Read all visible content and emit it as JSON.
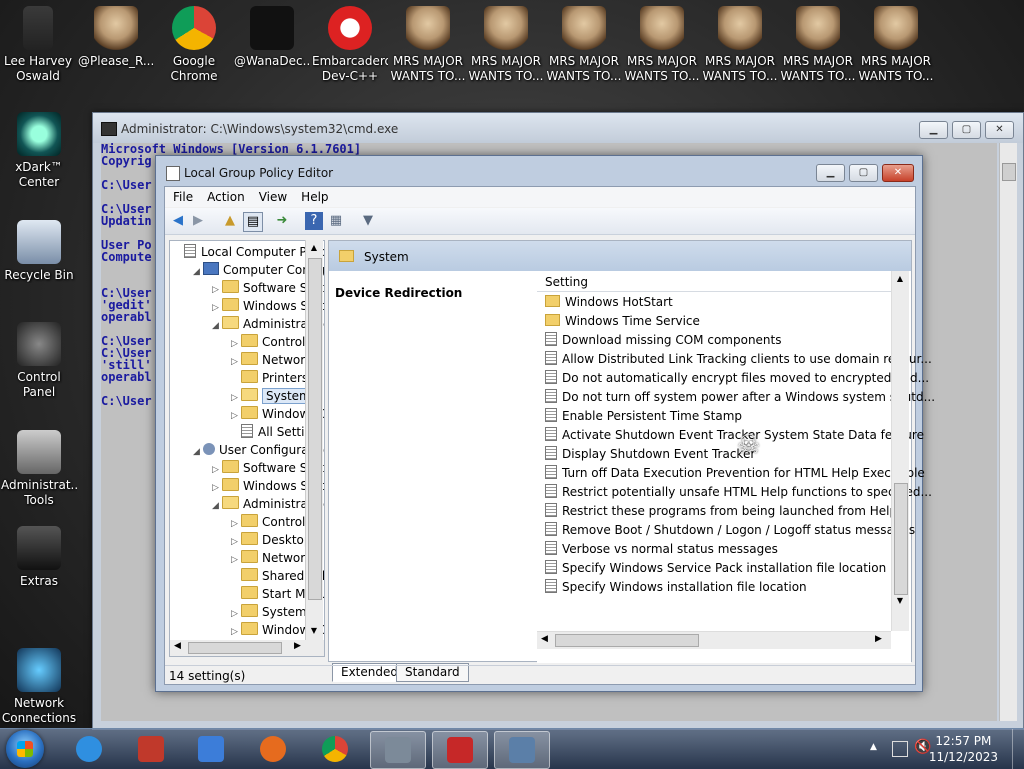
{
  "desktop": {
    "icons": [
      {
        "label": "Lee Harvey Oswald",
        "icon": "person-icon"
      },
      {
        "label": "@Please_R...",
        "icon": "skull-icon"
      },
      {
        "label": "Google Chrome",
        "icon": "chrome-icon"
      },
      {
        "label": "@WanaDec...",
        "icon": "file-icon"
      },
      {
        "label": "Embarcadero Dev-C++",
        "icon": "devcpp-icon"
      },
      {
        "label": "MRS MAJOR WANTS TO...",
        "icon": "skull-icon"
      },
      {
        "label": "MRS MAJOR WANTS TO...",
        "icon": "skull-icon"
      },
      {
        "label": "MRS MAJOR WANTS TO...",
        "icon": "skull-icon"
      },
      {
        "label": "MRS MAJOR WANTS TO...",
        "icon": "skull-icon"
      },
      {
        "label": "MRS MAJOR WANTS TO...",
        "icon": "skull-icon"
      },
      {
        "label": "MRS MAJOR WANTS TO...",
        "icon": "skull-icon"
      },
      {
        "label": "MRS MAJOR WANTS TO...",
        "icon": "skull-icon"
      }
    ],
    "left_icons": [
      {
        "label": "xDark™ Center",
        "icon": "xdark-icon"
      },
      {
        "label": "Recycle Bin",
        "icon": "recycle-bin-icon"
      },
      {
        "label": "Control Panel",
        "icon": "control-panel-icon"
      },
      {
        "label": "Administrat... Tools",
        "icon": "admin-tools-icon"
      },
      {
        "label": "Extras",
        "icon": "extras-icon"
      },
      {
        "label": "Network Connections",
        "icon": "network-icon"
      }
    ]
  },
  "cmd": {
    "title": "Administrator: C:\\Windows\\system32\\cmd.exe",
    "lines": [
      "Microsoft Windows [Version 6.1.7601]",
      "Copyrig",
      "",
      "C:\\User",
      "",
      "C:\\User",
      "Updatin",
      "",
      "User Po",
      "Compute",
      "",
      "",
      "C:\\User",
      "'gedit'",
      "operabl",
      "",
      "C:\\User",
      "C:\\User",
      "'still'",
      "operabl",
      "",
      "C:\\User"
    ]
  },
  "gpedit": {
    "title": "Local Group Policy Editor",
    "menu": [
      "File",
      "Action",
      "View",
      "Help"
    ],
    "tree": [
      {
        "label": "Local Computer Polic",
        "indent": 0,
        "arrow": "",
        "icon": "policy-icon"
      },
      {
        "label": "Computer Config",
        "indent": 1,
        "arrow": "◢",
        "icon": "computer-icon"
      },
      {
        "label": "Software Setti",
        "indent": 2,
        "arrow": "▷",
        "icon": "folder"
      },
      {
        "label": "Windows Sett",
        "indent": 2,
        "arrow": "▷",
        "icon": "folder"
      },
      {
        "label": "Administrative",
        "indent": 2,
        "arrow": "◢",
        "icon": "folder-open"
      },
      {
        "label": "Control Pa",
        "indent": 3,
        "arrow": "▷",
        "icon": "folder"
      },
      {
        "label": "Network",
        "indent": 3,
        "arrow": "▷",
        "icon": "folder"
      },
      {
        "label": "Printers",
        "indent": 3,
        "arrow": "",
        "icon": "folder"
      },
      {
        "label": "System",
        "indent": 3,
        "arrow": "▷",
        "icon": "folder-open",
        "selected": true
      },
      {
        "label": "Windows C",
        "indent": 3,
        "arrow": "▷",
        "icon": "folder"
      },
      {
        "label": "All Setting",
        "indent": 3,
        "arrow": "",
        "icon": "settings-icon"
      },
      {
        "label": "User Configuratio",
        "indent": 1,
        "arrow": "◢",
        "icon": "user-icon"
      },
      {
        "label": "Software Setti",
        "indent": 2,
        "arrow": "▷",
        "icon": "folder"
      },
      {
        "label": "Windows Sett",
        "indent": 2,
        "arrow": "▷",
        "icon": "folder"
      },
      {
        "label": "Administrative",
        "indent": 2,
        "arrow": "◢",
        "icon": "folder-open"
      },
      {
        "label": "Control Pa",
        "indent": 3,
        "arrow": "▷",
        "icon": "folder"
      },
      {
        "label": "Desktop",
        "indent": 3,
        "arrow": "▷",
        "icon": "folder"
      },
      {
        "label": "Network",
        "indent": 3,
        "arrow": "▷",
        "icon": "folder"
      },
      {
        "label": "Shared Fol",
        "indent": 3,
        "arrow": "",
        "icon": "folder"
      },
      {
        "label": "Start Menu",
        "indent": 3,
        "arrow": "",
        "icon": "folder"
      },
      {
        "label": "System",
        "indent": 3,
        "arrow": "▷",
        "icon": "folder"
      },
      {
        "label": "Windows C",
        "indent": 3,
        "arrow": "▷",
        "icon": "folder"
      }
    ],
    "right_header": "System",
    "description": "Device Redirection",
    "column_header": "Setting",
    "settings": [
      {
        "label": "Windows HotStart",
        "type": "folder"
      },
      {
        "label": "Windows Time Service",
        "type": "folder"
      },
      {
        "label": "Download missing COM components",
        "type": "policy"
      },
      {
        "label": "Allow Distributed Link Tracking clients to use domain resour...",
        "type": "policy"
      },
      {
        "label": "Do not automatically encrypt files moved to encrypted fold...",
        "type": "policy"
      },
      {
        "label": "Do not turn off system power after a Windows system shutd...",
        "type": "policy"
      },
      {
        "label": "Enable Persistent Time Stamp",
        "type": "policy"
      },
      {
        "label": "Activate Shutdown Event Tracker System State Data feature",
        "type": "policy"
      },
      {
        "label": "Display Shutdown Event Tracker",
        "type": "policy"
      },
      {
        "label": "Turn off Data Execution Prevention for HTML Help Executible",
        "type": "policy"
      },
      {
        "label": "Restrict potentially unsafe HTML Help functions to specified...",
        "type": "policy"
      },
      {
        "label": "Restrict these programs from being launched from Help",
        "type": "policy"
      },
      {
        "label": "Remove Boot / Shutdown / Logon / Logoff status messages",
        "type": "policy"
      },
      {
        "label": "Verbose vs normal status messages",
        "type": "policy"
      },
      {
        "label": "Specify Windows Service Pack installation file location",
        "type": "policy"
      },
      {
        "label": "Specify Windows installation file location",
        "type": "policy"
      }
    ],
    "tabs": [
      "Extended",
      "Standard"
    ],
    "status": "14 setting(s)"
  },
  "taskbar": {
    "apps": [
      {
        "name": "internet-explorer-icon",
        "color": "#2f8fe0"
      },
      {
        "name": "archive-icon",
        "color": "#c0392b"
      },
      {
        "name": "music-icon",
        "color": "#3c7dd9"
      },
      {
        "name": "firefox-icon",
        "color": "#e66b1e"
      },
      {
        "name": "chrome-icon",
        "color": "#3aa757"
      },
      {
        "name": "monitor-icon",
        "color": "#7c8a99"
      },
      {
        "name": "toolbox-icon",
        "color": "#c62828"
      },
      {
        "name": "settings-window-icon",
        "color": "#5b7fa8"
      }
    ],
    "time": "12:57 PM",
    "date": "11/12/2023"
  }
}
